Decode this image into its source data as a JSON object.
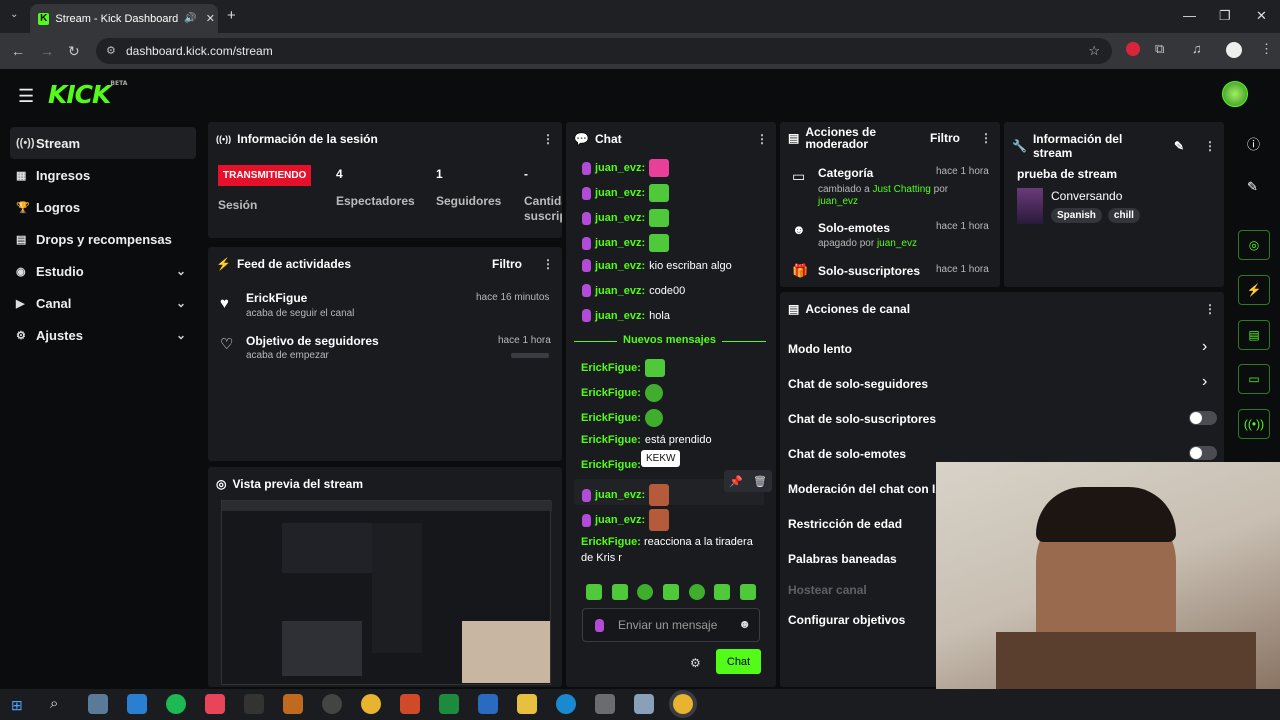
{
  "browser": {
    "tab_title": "Stream - Kick Dashboard",
    "url": "dashboard.kick.com/stream",
    "new_tab": "+"
  },
  "app": {
    "logo": "KICK",
    "beta": "BETA"
  },
  "sidebar": {
    "items": [
      {
        "label": "Stream",
        "icon": "broadcast-icon",
        "active": true,
        "chev": false
      },
      {
        "label": "Ingresos",
        "icon": "revenue-icon",
        "chev": false
      },
      {
        "label": "Logros",
        "icon": "trophy-icon",
        "chev": false
      },
      {
        "label": "Drops y recompensas",
        "icon": "drops-icon",
        "chev": false
      },
      {
        "label": "Estudio",
        "icon": "studio-icon",
        "chev": true
      },
      {
        "label": "Canal",
        "icon": "channel-icon",
        "chev": true
      },
      {
        "label": "Ajustes",
        "icon": "gear-icon",
        "chev": true
      }
    ]
  },
  "session": {
    "title": "Información de la sesión",
    "status": "TRANSMITIENDO",
    "status_label": "Sesión",
    "stats": [
      {
        "value": "4",
        "label": "Espectadores"
      },
      {
        "value": "1",
        "label": "Seguidores"
      },
      {
        "value": "-",
        "label": "Cantida suscrip"
      }
    ]
  },
  "feed": {
    "title": "Feed de actividades",
    "filter": "Filtro",
    "items": [
      {
        "name": "ErickFigue",
        "sub": "acaba de seguir el canal",
        "time": "hace 16 minutos"
      },
      {
        "name": "Objetivo de seguidores",
        "sub": "acaba de empezar",
        "time": "hace 1 hora"
      }
    ]
  },
  "preview": {
    "title": "Vista previa del stream"
  },
  "chat": {
    "title": "Chat",
    "new_messages": "Nuevos mensajes",
    "tooltip": "KEKW",
    "placeholder": "Enviar un mensaje",
    "send": "Chat",
    "old": [
      {
        "user": "juan_evz:",
        "text": "",
        "emote": "p"
      },
      {
        "user": "juan_evz:",
        "text": "",
        "emote": "g"
      },
      {
        "user": "juan_evz:",
        "text": "",
        "emote": "g"
      },
      {
        "user": "juan_evz:",
        "text": "",
        "emote": "g"
      },
      {
        "user": "juan_evz:",
        "text": "kio escriban algo",
        "emote": ""
      },
      {
        "user": "juan_evz:",
        "text": "code00",
        "emote": ""
      },
      {
        "user": "juan_evz:",
        "text": "hola",
        "emote": ""
      }
    ],
    "new": [
      {
        "user": "ErickFigue:",
        "text": "",
        "emote": "g",
        "mic": false
      },
      {
        "user": "ErickFigue:",
        "text": "",
        "emote": "c",
        "mic": false
      },
      {
        "user": "ErickFigue:",
        "text": "",
        "emote": "c",
        "mic": false
      },
      {
        "user": "ErickFigue:",
        "text": "está prendido",
        "emote": "",
        "mic": false
      },
      {
        "user": "ErickFigue:",
        "text": "",
        "emote": "",
        "mic": false
      },
      {
        "user": "juan_evz:",
        "text": "",
        "emote": "r",
        "mic": true
      },
      {
        "user": "juan_evz:",
        "text": "",
        "emote": "r",
        "mic": true
      }
    ],
    "last_user": "ErickFigue:",
    "last_text": "reacciona a la tiradera",
    "last_text2": "de Kris r"
  },
  "mod": {
    "title_1": "Acciones de",
    "title_2": "moderador",
    "filter": "Filtro",
    "items": [
      {
        "title": "Categoría",
        "time": "hace 1 hora",
        "l1a": "cambiado a ",
        "l1b": "Just Chatting",
        "l1c": " por",
        "l2": "juan_evz"
      },
      {
        "title": "Solo-emotes",
        "time": "hace 1 hora",
        "l1a": "apagado por ",
        "l1b": "juan_evz",
        "l1c": "",
        "l2": ""
      },
      {
        "title": "Solo-suscriptores",
        "time": "hace 1 hora",
        "l1a": "",
        "l1b": "",
        "l1c": "",
        "l2": ""
      }
    ]
  },
  "stream_info": {
    "title": "Información del stream",
    "name": "prueba de stream",
    "category": "Conversando",
    "tags": [
      "Spanish",
      "chill"
    ]
  },
  "channel_actions": {
    "title": "Acciones de canal",
    "items": [
      {
        "label": "Modo lento",
        "control": "chevron"
      },
      {
        "label": "Chat de solo-seguidores",
        "control": "chevron"
      },
      {
        "label": "Chat de solo-suscriptores",
        "control": "toggle"
      },
      {
        "label": "Chat de solo-emotes",
        "control": "toggle"
      },
      {
        "label": "Moderación del chat con IA",
        "control": ""
      },
      {
        "label": "Restricción de edad",
        "control": ""
      },
      {
        "label": "Palabras baneadas",
        "control": ""
      },
      {
        "label": "Hostear canal",
        "control": "",
        "disabled": true
      },
      {
        "label": "Configurar objetivos",
        "control": ""
      }
    ]
  }
}
